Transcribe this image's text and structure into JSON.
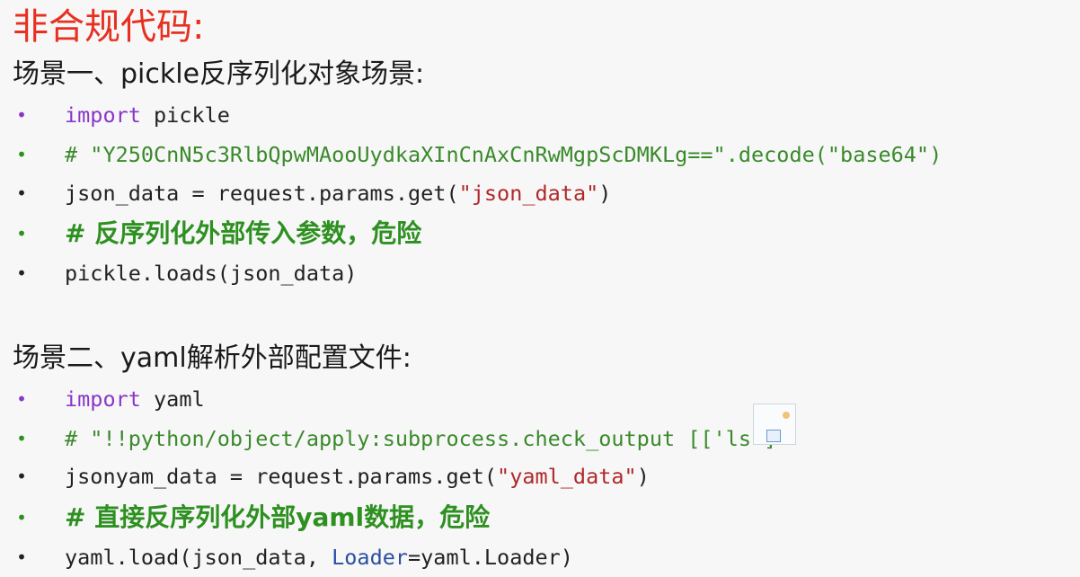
{
  "title": "非合规代码:",
  "scenario1": {
    "heading": "场景一、pickle反序列化对象场景:",
    "lines": [
      {
        "keyword": "import",
        "rest": " pickle"
      },
      {
        "comment": "# \"Y250CnN5c3RlbQpwMAooUydkaXInCnAxCnRwMgpScDMKLg==\".decode(\"base64\")"
      },
      {
        "pre": "json_data = request.params.get(",
        "string": "\"json_data\"",
        "post": ")"
      },
      {
        "comment_cn": "# 反序列化外部传入参数，危险"
      },
      {
        "text": "pickle.loads(json_data)"
      }
    ]
  },
  "scenario2": {
    "heading": "场景二、yaml解析外部配置文件:",
    "lines": [
      {
        "keyword": "import",
        "rest": " yaml"
      },
      {
        "comment": "# \"!!python/object/apply:subprocess.check_output [['ls']\""
      },
      {
        "pre": "jsonyam_data = request.params.get(",
        "string": "\"yaml_data\"",
        "post": ")"
      },
      {
        "comment_cn": "# 直接反序列化外部yaml数据，危险"
      },
      {
        "pre": "yaml.load(json_data,  ",
        "param": "Loader",
        "post": "=yaml.Loader)"
      }
    ]
  },
  "bullet_char": "•",
  "icons": [
    "image-insert-icon"
  ],
  "colors": {
    "title": "#e8301f",
    "keyword": "#8a36c8",
    "comment": "#3a8a2a",
    "string": "#b02828",
    "param": "#2a4fa0"
  }
}
